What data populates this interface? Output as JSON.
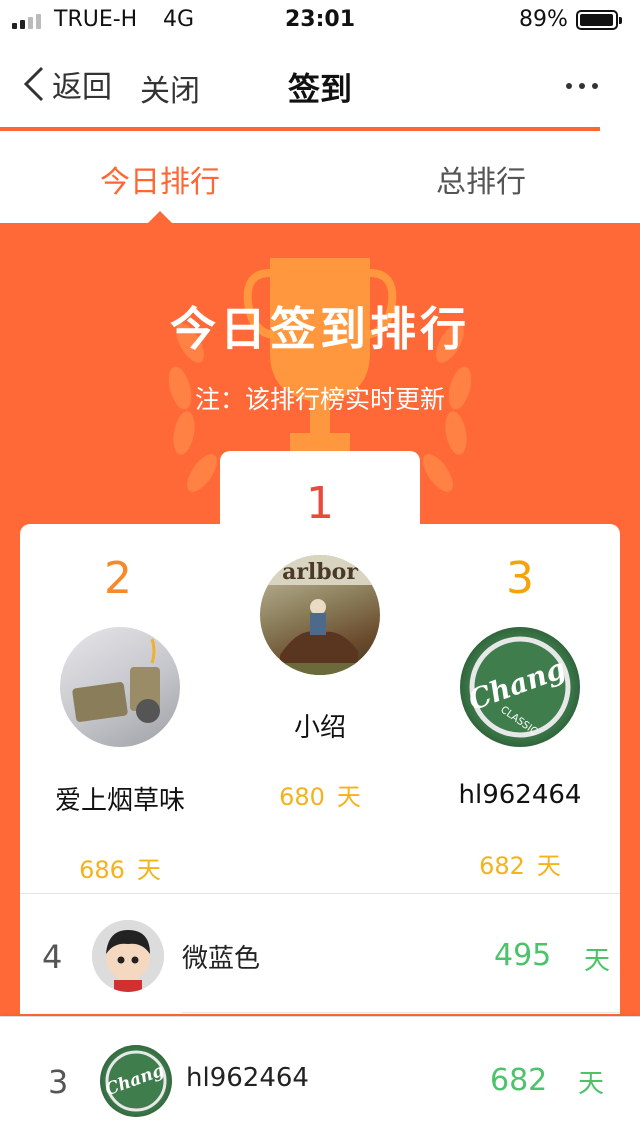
{
  "status_bar": {
    "carrier": "TRUE-H",
    "network": "4G",
    "time": "23:01",
    "battery": "89%",
    "battery_level": 0.89
  },
  "nav": {
    "back_label": "返回",
    "close_label": "关闭",
    "title": "签到"
  },
  "tabs": [
    {
      "label": "今日排行",
      "active": true
    },
    {
      "label": "总排行",
      "active": false
    }
  ],
  "banner": {
    "title": "今日签到排行",
    "note": "注：该排行榜实时更新"
  },
  "podium": [
    {
      "rank": "1",
      "name": "小绍",
      "days": "680",
      "unit": "天",
      "avatar": "cowboy-horse-photo"
    },
    {
      "rank": "2",
      "name": "爱上烟草味",
      "days": "686",
      "unit": "天",
      "avatar": "lighter-photo"
    },
    {
      "rank": "3",
      "name": "hl962464",
      "days": "682",
      "unit": "天",
      "avatar": "chang-beer-cap"
    }
  ],
  "list": [
    {
      "rank": "4",
      "name": "微蓝色",
      "days": "495",
      "unit": "天",
      "avatar": "cartoon-boy"
    }
  ],
  "my_rank": {
    "rank": "3",
    "name": "hl962464",
    "days": "682",
    "unit": "天",
    "avatar": "chang-beer-cap"
  },
  "colors": {
    "accent": "#ff6633",
    "banner": "#ff6937",
    "rank1": "#e84a3b",
    "rank2": "#f68a2a",
    "rank3": "#f5a30d",
    "podium_days": "#f5b21a",
    "list_days": "#4cc36a"
  }
}
